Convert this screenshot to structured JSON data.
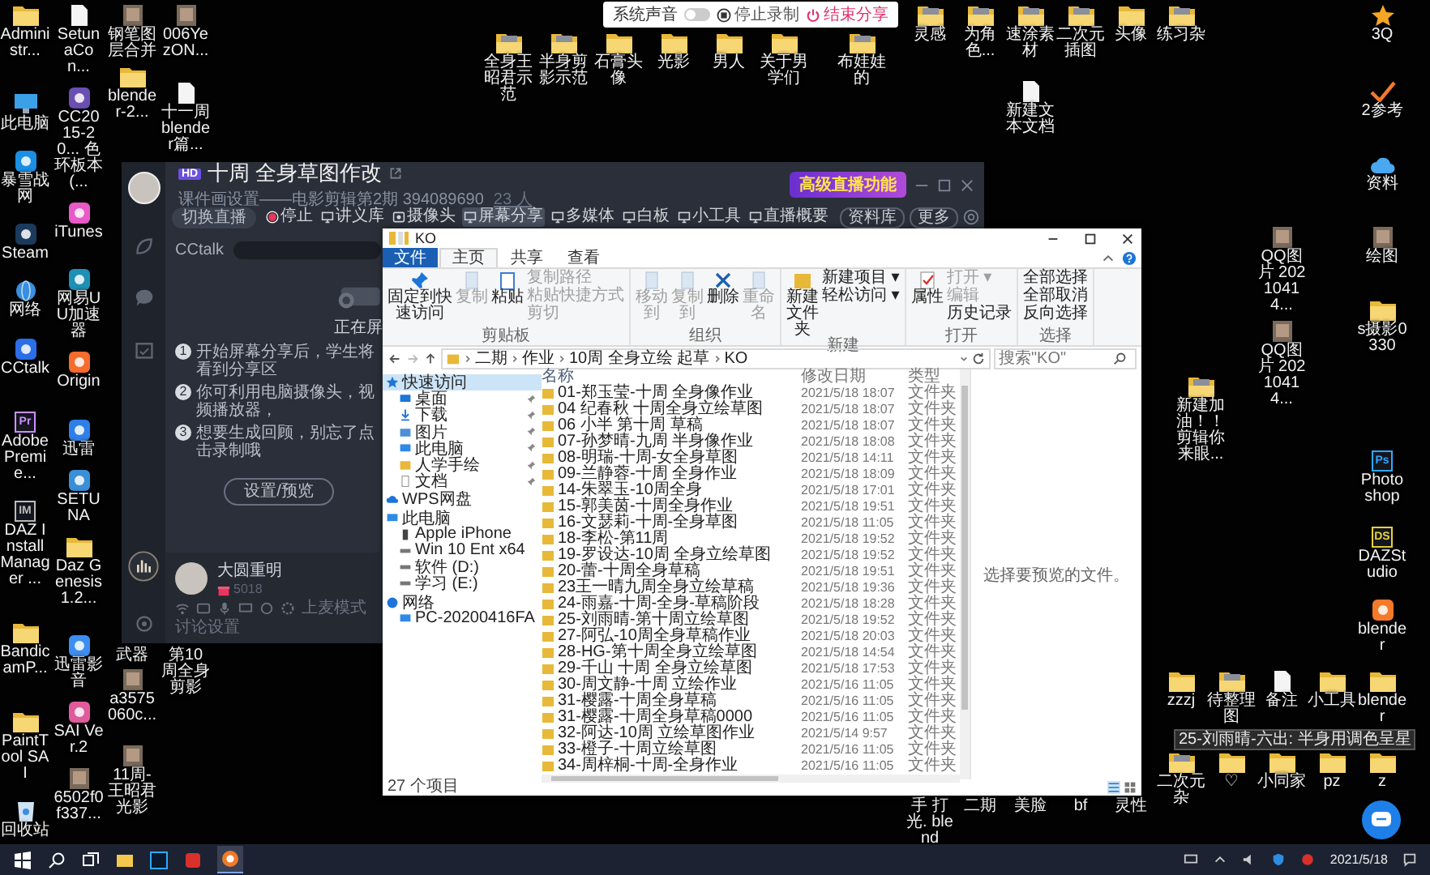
{
  "desktop": {
    "left_columns": [
      {
        "icons": [
          {
            "label": "Administr...",
            "kind": "folder"
          },
          {
            "label": "此电脑",
            "kind": "computer"
          },
          {
            "label": "暴雪战网",
            "kind": "app",
            "color": "#1a8fe3"
          },
          {
            "label": "Steam",
            "kind": "app",
            "color": "#1b3a5c"
          },
          {
            "label": "网络",
            "kind": "network"
          },
          {
            "label": "CCtalk",
            "kind": "app",
            "color": "#2b6ee8"
          },
          {
            "label": "Adobe Premie...",
            "kind": "lettered",
            "glyph": "Pr",
            "color": "#c792ff"
          },
          {
            "label": "DAZ Install Manager ...",
            "kind": "lettered",
            "glyph": "IM",
            "color": "#bbbbbb"
          },
          {
            "label": "BandicamP...",
            "kind": "folder"
          },
          {
            "label": "PaintTool SAI",
            "kind": "folder"
          },
          {
            "label": "回收站",
            "kind": "recycle"
          }
        ]
      },
      {
        "icons": [
          {
            "label": "SetunaCon...",
            "kind": "doc"
          },
          {
            "label": "CC2015-20... 色环板本 (...",
            "kind": "app",
            "color": "#6a4fb3"
          },
          {
            "label": "iTunes",
            "kind": "app",
            "color": "#e85ac8"
          },
          {
            "label": "网易UU加速器",
            "kind": "app",
            "color": "#1f8fb5"
          },
          {
            "label": "Origin",
            "kind": "app",
            "color": "#f56c2d"
          },
          {
            "label": "迅雷",
            "kind": "app",
            "color": "#2f7fe8"
          },
          {
            "label": "SETUNA",
            "kind": "app",
            "color": "#3a8fd6"
          },
          {
            "label": "Daz Genesis1.2...",
            "kind": "folder"
          },
          {
            "label": "迅雷影音",
            "kind": "app",
            "color": "#3d8ef0"
          },
          {
            "label": "SAI Ver.2",
            "kind": "app",
            "color": "#e05b9b"
          },
          {
            "label": "6502f0f337...",
            "kind": "photo"
          }
        ]
      },
      {
        "icons": [
          {
            "label": "钢笔图层合并",
            "kind": "photo"
          },
          {
            "label": "blender-2...",
            "kind": "folder"
          }
        ],
        "lower_icons": [
          {
            "label": "武器",
            "kind": "label"
          },
          {
            "label": "a3575060c...",
            "kind": "photo"
          },
          {
            "label": "11周-王昭君光影",
            "kind": "photo"
          }
        ]
      },
      {
        "icons": [
          {
            "label": "006YezON...",
            "kind": "photo"
          },
          {
            "label": "十一周 blender篇...",
            "kind": "doc"
          }
        ],
        "lower_icons": [
          {
            "label": "第10周全身剪影",
            "kind": "label"
          }
        ]
      }
    ],
    "top_icons": [
      {
        "label": "全身王昭君示范",
        "kind": "photo_folder"
      },
      {
        "label": "半身剪影示范",
        "kind": "photo_folder"
      },
      {
        "label": "石膏头像",
        "kind": "folder"
      },
      {
        "label": "光影",
        "kind": "folder"
      },
      {
        "label": "男人",
        "kind": "folder"
      },
      {
        "label": "关于男学们",
        "kind": "folder"
      },
      {
        "label": "布娃娃的",
        "kind": "photo_folder"
      }
    ],
    "right_icons": [
      {
        "label": "灵感",
        "kind": "photo_folder"
      },
      {
        "label": "为角色...",
        "kind": "photo_folder"
      },
      {
        "label": "速涂素材",
        "kind": "photo_folder"
      },
      {
        "label": "二次元插图",
        "kind": "photo_folder"
      },
      {
        "label": "头像",
        "kind": "folder"
      },
      {
        "label": "练习杂",
        "kind": "photo_folder"
      },
      {
        "label": "3Q",
        "kind": "star"
      },
      {
        "label": "新建文本文档",
        "kind": "doc"
      },
      {
        "label": "2参考",
        "kind": "check"
      },
      {
        "label": "资料",
        "kind": "cloud"
      },
      {
        "label": "QQ图片 20210414...",
        "kind": "photo"
      },
      {
        "label": "绘图",
        "kind": "photo"
      },
      {
        "label": "QQ图片 20210414...",
        "kind": "photo"
      },
      {
        "label": "s摄影0330",
        "kind": "folder"
      },
      {
        "label": "新建加油！！剪辑你来眼...",
        "kind": "photo_folder"
      },
      {
        "label": "Photoshop",
        "kind": "lettered",
        "glyph": "Ps",
        "color": "#31a8ff"
      },
      {
        "label": "DAZStudio",
        "kind": "lettered",
        "glyph": "DS",
        "color": "#e5d33a"
      },
      {
        "label": "blender",
        "kind": "app",
        "color": "#f5792a"
      },
      {
        "label": "zzzj",
        "kind": "folder"
      },
      {
        "label": "待整理图",
        "kind": "photo_folder"
      },
      {
        "label": "备注",
        "kind": "doc"
      },
      {
        "label": "小工具",
        "kind": "folder"
      },
      {
        "label": "blender",
        "kind": "folder"
      },
      {
        "label": "手 打光. blend",
        "kind": "label"
      },
      {
        "label": "二期",
        "kind": "label"
      },
      {
        "label": "美脸",
        "kind": "label"
      },
      {
        "label": "bf",
        "kind": "label"
      },
      {
        "label": "灵性",
        "kind": "label"
      },
      {
        "label": "二次元杂",
        "kind": "photo_folder"
      },
      {
        "label": "♡",
        "kind": "folder"
      },
      {
        "label": "小同家",
        "kind": "folder"
      },
      {
        "label": "pz",
        "kind": "folder"
      },
      {
        "label": "z",
        "kind": "folder"
      }
    ]
  },
  "recording_bar": {
    "sound_label": "系统声音",
    "sound_on": false,
    "stop_label": "停止录制",
    "end_label": "结束分享"
  },
  "cctalk": {
    "quality_badge": "HD",
    "title": "十周 全身草图作改",
    "subtitle": "课件画设置——电影剪辑第2期 394089690",
    "member_count": "23 人",
    "promo": "高级直播功能",
    "toolbar": [
      {
        "label": "切换直播",
        "kind": "pill",
        "selected": false
      },
      {
        "label": "停止",
        "kind": "record",
        "selected": false
      },
      {
        "label": "讲义库",
        "kind": "slides",
        "selected": false
      },
      {
        "label": "摄像头",
        "kind": "camera",
        "selected": false
      },
      {
        "label": "屏幕分享",
        "kind": "screen",
        "selected": true
      },
      {
        "label": "多媒体",
        "kind": "media",
        "selected": false
      },
      {
        "label": "白板",
        "kind": "board",
        "selected": false
      },
      {
        "label": "小工具",
        "kind": "tools",
        "selected": false
      },
      {
        "label": "直播概要",
        "kind": "summary",
        "selected": false
      }
    ],
    "side_buttons": [
      "资料库",
      "更多"
    ],
    "chat_label": "CCtalk",
    "sharing_heading": "正在屏",
    "steps": [
      {
        "number": "1",
        "text": "开始屏幕分享后，学生将看到分享区"
      },
      {
        "number": "2",
        "text": "你可利用电脑摄像头，视频播放器，"
      },
      {
        "number": "3",
        "text": "想要生成回顾，别忘了点击录制哦"
      }
    ],
    "preview_button": "设置/预览",
    "user": {
      "name": "大圆重明",
      "points": "5018"
    },
    "bottom_tools": [
      {
        "kind": "wifi"
      },
      {
        "kind": "camera"
      },
      {
        "kind": "mic"
      },
      {
        "kind": "screen"
      },
      {
        "kind": "sync"
      },
      {
        "kind": "gear"
      }
    ],
    "mode_buttons": [
      "上麦模式",
      "讨论设置"
    ]
  },
  "explorer": {
    "title": "KO",
    "tabs": [
      {
        "label": "文件",
        "kind": "menu",
        "selected": false
      },
      {
        "label": "主页",
        "kind": "tab",
        "selected": true
      },
      {
        "label": "共享",
        "kind": "tab",
        "selected": false
      },
      {
        "label": "查看",
        "kind": "tab",
        "selected": false
      }
    ],
    "ribbon": [
      {
        "label": "剪贴板",
        "large": [
          {
            "label": "固定到快速访问",
            "kind": "pin",
            "disabled": false
          },
          {
            "label": "复制",
            "kind": "copy",
            "disabled": true
          },
          {
            "label": "粘贴",
            "kind": "paste",
            "disabled": false
          }
        ],
        "small": [
          {
            "label": "复制路径",
            "disabled": true
          },
          {
            "label": "粘贴快捷方式",
            "disabled": true
          },
          {
            "label": "剪切",
            "disabled": true
          }
        ]
      },
      {
        "label": "组织",
        "large": [
          {
            "label": "移动到",
            "kind": "move",
            "disabled": true
          },
          {
            "label": "复制到",
            "kind": "copy",
            "disabled": true
          },
          {
            "label": "删除",
            "kind": "delete",
            "disabled": false
          },
          {
            "label": "重命名",
            "kind": "rename",
            "disabled": true
          }
        ]
      },
      {
        "label": "新建",
        "large": [
          {
            "label": "新建文件夹",
            "kind": "folder",
            "disabled": false
          }
        ],
        "small": [
          {
            "label": "新建项目 ▾",
            "disabled": false
          },
          {
            "label": "轻松访问 ▾",
            "disabled": false
          }
        ]
      },
      {
        "label": "打开",
        "large": [
          {
            "label": "属性",
            "kind": "properties",
            "disabled": false
          }
        ],
        "small": [
          {
            "label": "打开 ▾",
            "disabled": true
          },
          {
            "label": "编辑",
            "disabled": true
          },
          {
            "label": "历史记录",
            "disabled": false
          }
        ]
      },
      {
        "label": "选择",
        "small": [
          {
            "label": "全部选择",
            "disabled": false
          },
          {
            "label": "全部取消",
            "disabled": false
          },
          {
            "label": "反向选择",
            "disabled": false
          }
        ]
      }
    ],
    "path": [
      "二期",
      "作业",
      "10周 全身立绘 起草",
      "KO"
    ],
    "search_placeholder": "搜索\"KO\"",
    "nav": [
      {
        "label": "快速访问",
        "kind": "star",
        "selected": true,
        "children": [
          {
            "label": "桌面",
            "kind": "desktop",
            "pinned": true,
            "selected": false
          },
          {
            "label": "下载",
            "kind": "download",
            "pinned": true,
            "selected": false
          },
          {
            "label": "图片",
            "kind": "pictures",
            "pinned": true,
            "selected": false
          },
          {
            "label": "此电脑",
            "kind": "pc",
            "pinned": true,
            "selected": false
          },
          {
            "label": "人学手绘",
            "kind": "folder",
            "pinned": true,
            "selected": false
          },
          {
            "label": "文档",
            "kind": "docs",
            "pinned": true,
            "selected": false
          }
        ]
      },
      {
        "label": "WPS网盘",
        "kind": "cloud",
        "selected": false
      },
      {
        "label": "此电脑",
        "kind": "pc",
        "selected": false,
        "children": [
          {
            "label": "Apple iPhone",
            "kind": "phone",
            "pinned": false,
            "selected": false
          },
          {
            "label": "Win 10 Ent x64",
            "kind": "drive",
            "pinned": false,
            "selected": false
          },
          {
            "label": "软件 (D:)",
            "kind": "drive",
            "pinned": false,
            "selected": false
          },
          {
            "label": "学习 (E:)",
            "kind": "drive",
            "pinned": false,
            "selected": false
          }
        ]
      },
      {
        "label": "网络",
        "kind": "network",
        "selected": false,
        "children": [
          {
            "label": "PC-20200416FA",
            "kind": "pc",
            "pinned": false,
            "selected": false
          }
        ]
      }
    ],
    "columns": [
      "名称",
      "修改日期",
      "类型"
    ],
    "rows": [
      {
        "name": "01-郑玉莹-十周 全身像作业",
        "date": "2021/5/18 18:07",
        "type": "文件夹"
      },
      {
        "name": "04 纪春秋 十周全身立绘草图",
        "date": "2021/5/18 18:07",
        "type": "文件夹"
      },
      {
        "name": "06 小半 第十周 草稿",
        "date": "2021/5/18 18:07",
        "type": "文件夹"
      },
      {
        "name": "07-孙梦晴-九周 半身像作业",
        "date": "2021/5/18 18:08",
        "type": "文件夹"
      },
      {
        "name": "08-明瑞-十周-女全身草图",
        "date": "2021/5/18 14:11",
        "type": "文件夹"
      },
      {
        "name": "09-兰静蓉-十周 全身作业",
        "date": "2021/5/18 18:09",
        "type": "文件夹"
      },
      {
        "name": "14-朱翠玉-10周全身",
        "date": "2021/5/18 17:01",
        "type": "文件夹"
      },
      {
        "name": "15-郭美茵-十周全身作业",
        "date": "2021/5/18 19:51",
        "type": "文件夹"
      },
      {
        "name": "16-文瑟莉-十周-全身草图",
        "date": "2021/5/18 11:05",
        "type": "文件夹"
      },
      {
        "name": "18-李松-第11周",
        "date": "2021/5/18 19:52",
        "type": "文件夹"
      },
      {
        "name": "19-罗设达-10周 全身立绘草图",
        "date": "2021/5/18 19:52",
        "type": "文件夹"
      },
      {
        "name": "20-蕾-十周全身草稿",
        "date": "2021/5/18 19:51",
        "type": "文件夹"
      },
      {
        "name": "23王一晴九周全身立绘草稿",
        "date": "2021/5/18 19:36",
        "type": "文件夹"
      },
      {
        "name": "24-雨嘉-十周-全身-草稿阶段",
        "date": "2021/5/18 18:28",
        "type": "文件夹"
      },
      {
        "name": "25-刘雨晴-第十周立绘草图",
        "date": "2021/5/18 19:52",
        "type": "文件夹"
      },
      {
        "name": "27-阿弘-10周全身草稿作业",
        "date": "2021/5/18 20:03",
        "type": "文件夹"
      },
      {
        "name": "28-HG-第十周全身立绘草图",
        "date": "2021/5/18 14:54",
        "type": "文件夹"
      },
      {
        "name": "29-千山 十周 全身立绘草图",
        "date": "2021/5/18 17:53",
        "type": "文件夹"
      },
      {
        "name": "30-周文静-十周 立绘作业",
        "date": "2021/5/16 11:05",
        "type": "文件夹"
      },
      {
        "name": "31-樱露-十周全身草稿",
        "date": "2021/5/16 11:05",
        "type": "文件夹"
      },
      {
        "name": "31-樱露-十周全身草稿0000",
        "date": "2021/5/16 11:05",
        "type": "文件夹"
      },
      {
        "name": "32-阿达-10周 立绘草图作业",
        "date": "2021/5/14 9:57",
        "type": "文件夹"
      },
      {
        "name": "33-橙子-十周立绘草图",
        "date": "2021/5/16 11:05",
        "type": "文件夹"
      },
      {
        "name": "34-周梓桐-十周-全身作业",
        "date": "2021/5/16 11:05",
        "type": "文件夹"
      }
    ],
    "preview_text": "选择要预览的文件。",
    "status": "27 个项目"
  },
  "tooltip": "25-刘雨晴-六出: 半身用调色呈星",
  "taskbar": {
    "apps": [
      {
        "kind": "start"
      },
      {
        "kind": "search"
      },
      {
        "kind": "task_view"
      },
      {
        "kind": "explorer"
      },
      {
        "kind": "photoshop"
      },
      {
        "kind": "red_app"
      },
      {
        "kind": "cctalk"
      }
    ],
    "tray": [
      {
        "kind": "monitor"
      },
      {
        "kind": "caret"
      },
      {
        "kind": "volume"
      },
      {
        "kind": "shield"
      },
      {
        "kind": "red_app"
      }
    ],
    "date": "2021/5/18"
  }
}
